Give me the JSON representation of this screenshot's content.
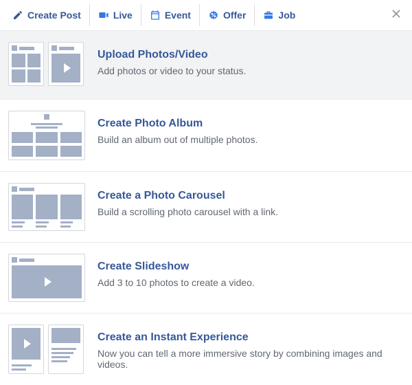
{
  "colors": {
    "brand": "#365899",
    "icon_gray": "#909090",
    "skeleton": "#a3b0c6"
  },
  "toolbar": {
    "create_post": "Create Post",
    "live": "Live",
    "event": "Event",
    "offer": "Offer",
    "job": "Job"
  },
  "options": [
    {
      "id": "upload-photos-video",
      "title": "Upload Photos/Video",
      "desc": "Add photos or video to your status.",
      "selected": true
    },
    {
      "id": "create-photo-album",
      "title": "Create Photo Album",
      "desc": "Build an album out of multiple photos.",
      "selected": false
    },
    {
      "id": "create-photo-carousel",
      "title": "Create a Photo Carousel",
      "desc": "Build a scrolling photo carousel with a link.",
      "selected": false
    },
    {
      "id": "create-slideshow",
      "title": "Create Slideshow",
      "desc": "Add 3 to 10 photos to create a video.",
      "selected": false
    },
    {
      "id": "create-instant-experience",
      "title": "Create an Instant Experience",
      "desc": "Now you can tell a more immersive story by combining images and videos.",
      "selected": false
    }
  ]
}
